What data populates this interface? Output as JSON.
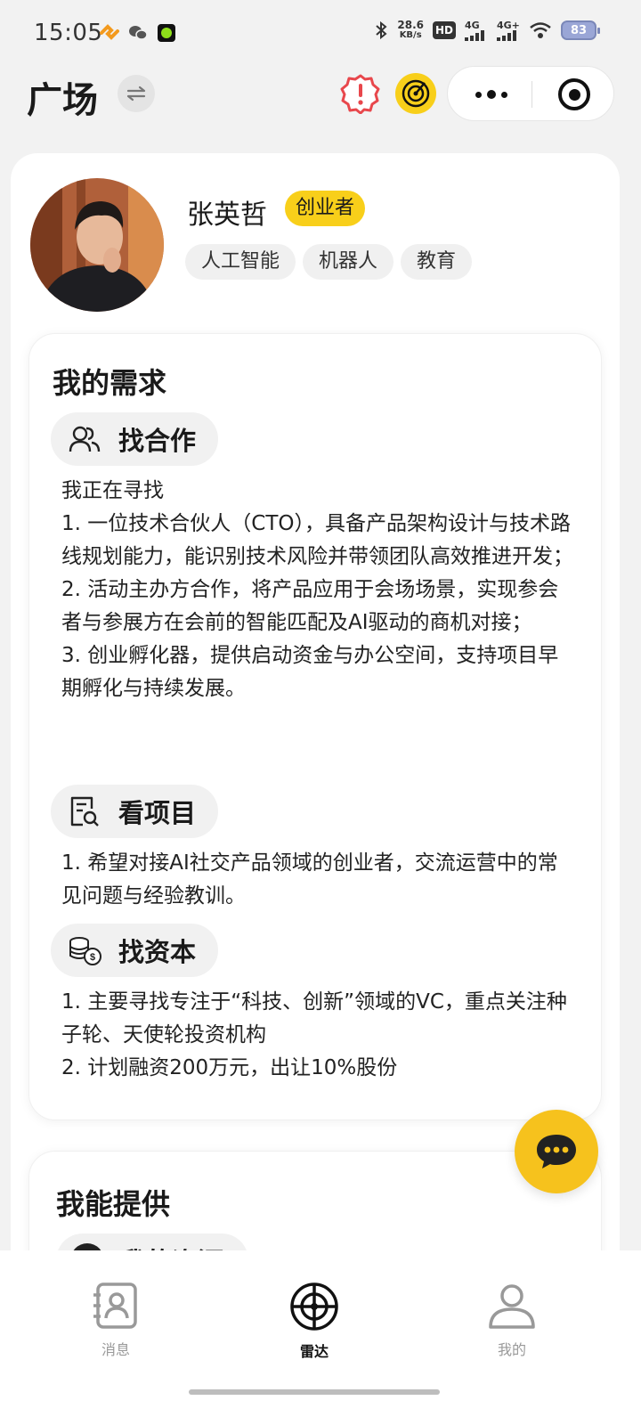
{
  "status_bar": {
    "time": "15:05",
    "net_speed_value": "28.6",
    "net_speed_unit": "KB/s",
    "hd_label": "HD",
    "sim1": "4G",
    "sim2": "4G+",
    "battery": "83"
  },
  "header": {
    "title": "广场"
  },
  "profile": {
    "name": "张英哲",
    "role": "创业者",
    "tags": [
      "人工智能",
      "机器人",
      "教育"
    ]
  },
  "needs": {
    "heading": "我的需求",
    "sections": [
      {
        "icon": "people-icon",
        "label": "找合作",
        "lines": [
          "我正在寻找",
          "1. 一位技术合伙人（CTO），具备产品架构设计与技术路线规划能力，能识别技术风险并带领团队高效推进开发；",
          "2. 活动主办方合作，将产品应用于会场场景，实现参会者与参展方在会前的智能匹配及AI驱动的商机对接；",
          "3. 创业孵化器，提供启动资金与办公空间，支持项目早期孵化与持续发展。"
        ]
      },
      {
        "icon": "document-search-icon",
        "label": "看项目",
        "lines": [
          "1. 希望对接AI社交产品领域的创业者，交流运营中的常见问题与经验教训。"
        ]
      },
      {
        "icon": "coins-icon",
        "label": "找资本",
        "lines": [
          "1. 主要寻找专注于“科技、创新”领域的VC，重点关注种子轮、天使轮投资机构",
          "2. 计划融资200万元，出让10%股份"
        ]
      }
    ]
  },
  "offer": {
    "heading": "我能提供",
    "first_pill": "我的资源"
  },
  "nav": {
    "items": [
      {
        "label": "消息",
        "icon": "contact-card-icon",
        "active": false
      },
      {
        "label": "雷达",
        "icon": "radar-icon",
        "active": true
      },
      {
        "label": "我的",
        "icon": "user-icon",
        "active": false
      }
    ]
  },
  "colors": {
    "accent": "#f8cf1a",
    "alert": "#e8474c",
    "background": "#f2f2f2"
  }
}
